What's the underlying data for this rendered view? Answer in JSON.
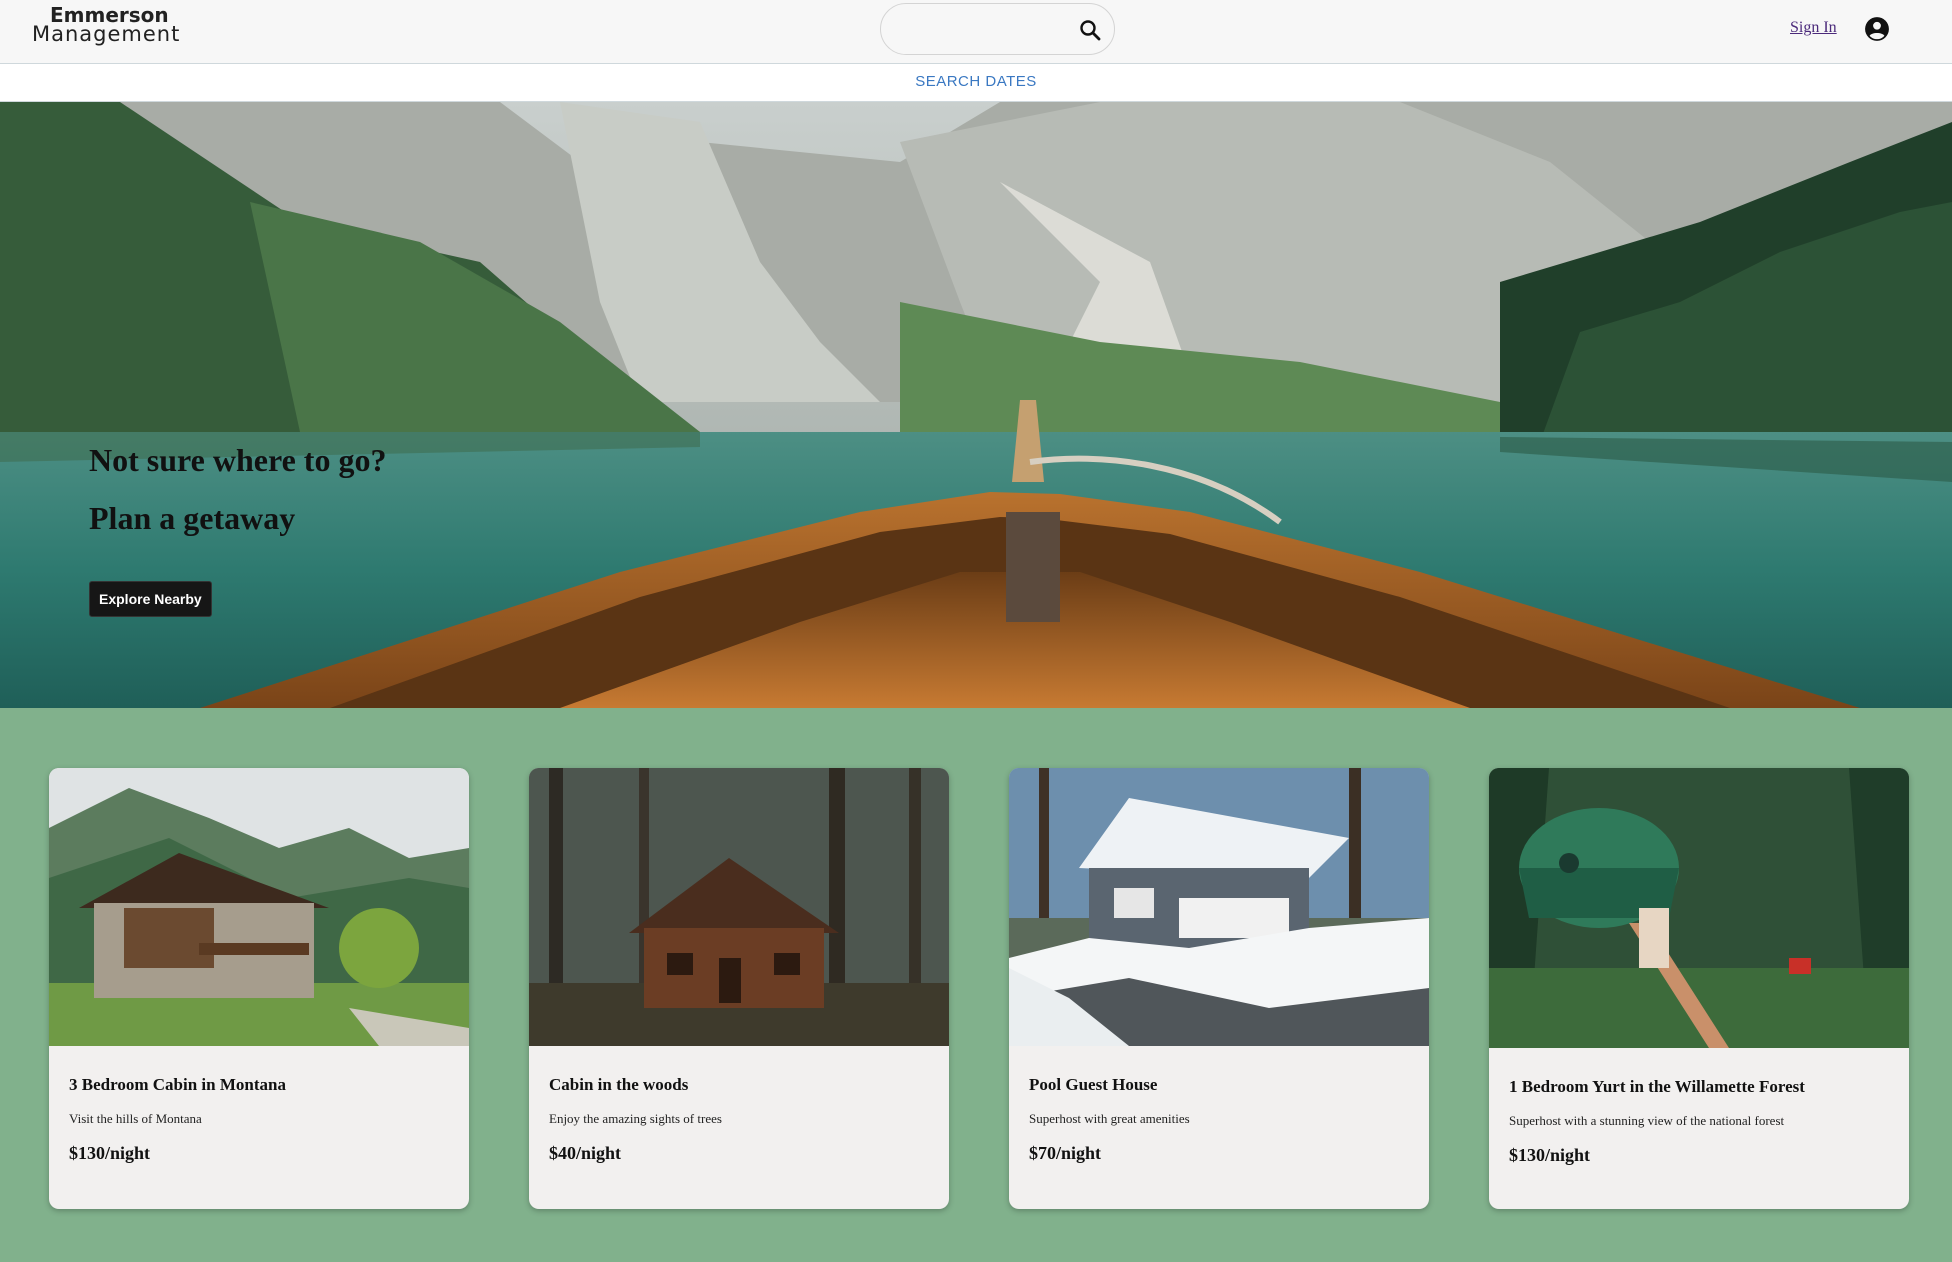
{
  "header": {
    "logo_line1": "Emmerson",
    "logo_line2": "Management",
    "search_placeholder": "",
    "search_icon": "search-icon",
    "signin_label": "Sign In",
    "account_icon": "account-circle-icon"
  },
  "dates_bar": {
    "label": "SEARCH DATES"
  },
  "hero": {
    "line1": "Not sure where to go?",
    "line2": "Plan a getaway",
    "button_label": "Explore Nearby"
  },
  "listings": [
    {
      "title": "3 Bedroom Cabin in Montana",
      "description": "Visit the hills of Montana",
      "price": "$130/night"
    },
    {
      "title": "Cabin in the woods",
      "description": "Enjoy the amazing sights of trees",
      "price": "$40/night"
    },
    {
      "title": "Pool Guest House",
      "description": "Superhost with great amenities",
      "price": "$70/night"
    },
    {
      "title": "1 Bedroom Yurt in the Willamette Forest",
      "description": "Superhost with a stunning view of the national forest",
      "price": "$130/night"
    }
  ],
  "colors": {
    "listings_background": "#81b18c",
    "card_background": "#f2f0ef",
    "signin_link": "#4b2a7b",
    "dates_label": "#3a78c2"
  }
}
